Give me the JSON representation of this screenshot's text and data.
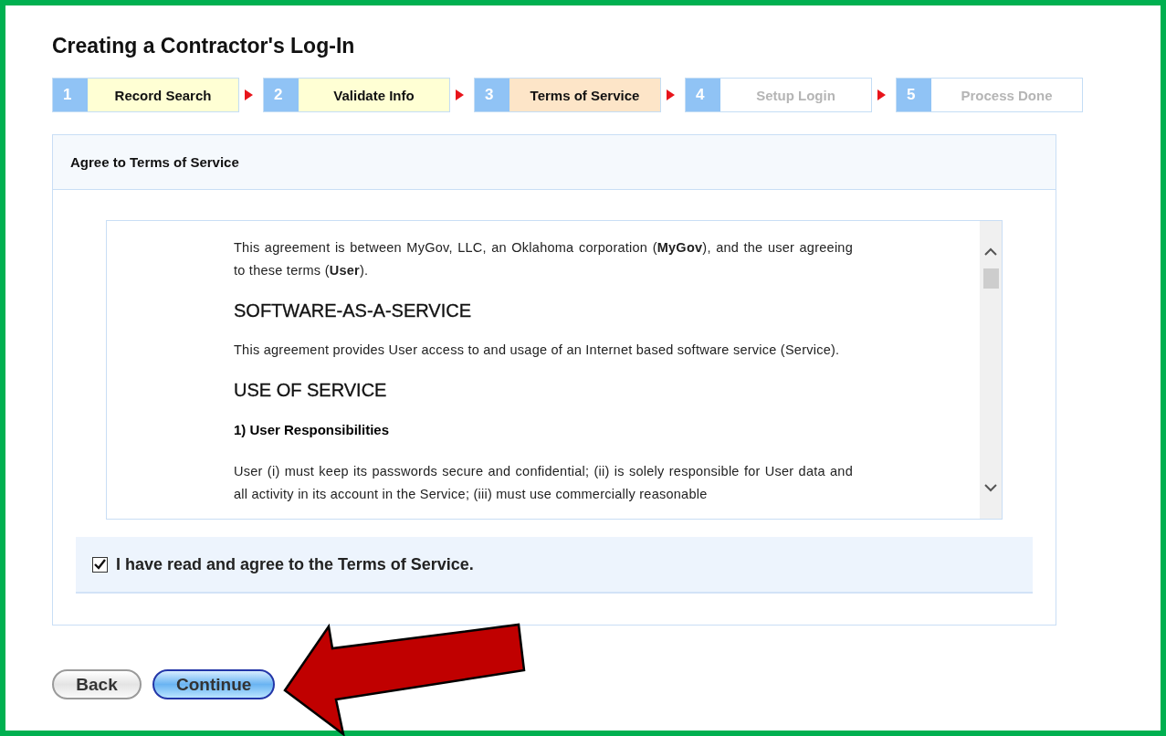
{
  "page": {
    "title": "Creating a Contractor's Log-In"
  },
  "steps": [
    {
      "number": "1",
      "label": "Record Search",
      "kind": "done"
    },
    {
      "number": "2",
      "label": "Validate Info",
      "kind": "done"
    },
    {
      "number": "3",
      "label": "Terms of Service",
      "kind": "current"
    },
    {
      "number": "4",
      "label": "Setup Login",
      "kind": "pending"
    },
    {
      "number": "5",
      "label": "Process Done",
      "kind": "pending"
    }
  ],
  "panel": {
    "title": "Agree to Terms of Service",
    "terms": [
      {
        "kind": "paragraph",
        "text": "This agreement is between MyGov, LLC, an Oklahoma corporation (**MyGov**), and the user agreeing to these terms (**User**)."
      },
      {
        "kind": "heading",
        "text": "SOFTWARE-AS-A-SERVICE"
      },
      {
        "kind": "paragraph",
        "text": "This agreement provides User access to and usage of an Internet based software service (Service)."
      },
      {
        "kind": "heading",
        "text": "USE OF SERVICE"
      },
      {
        "kind": "subheading",
        "text": "1) User Responsibilities"
      },
      {
        "kind": "paragraph",
        "text": "User (i) must keep its passwords secure and confidential; (ii) is solely responsible for User data and all activity in its account in the Service; (iii) must use commercially reasonable"
      }
    ],
    "agree": {
      "label": "I have read and agree to the Terms of Service.",
      "checked": true
    }
  },
  "buttons": [
    {
      "label": "Back",
      "kind": "secondary"
    },
    {
      "label": "Continue",
      "kind": "primary"
    }
  ]
}
